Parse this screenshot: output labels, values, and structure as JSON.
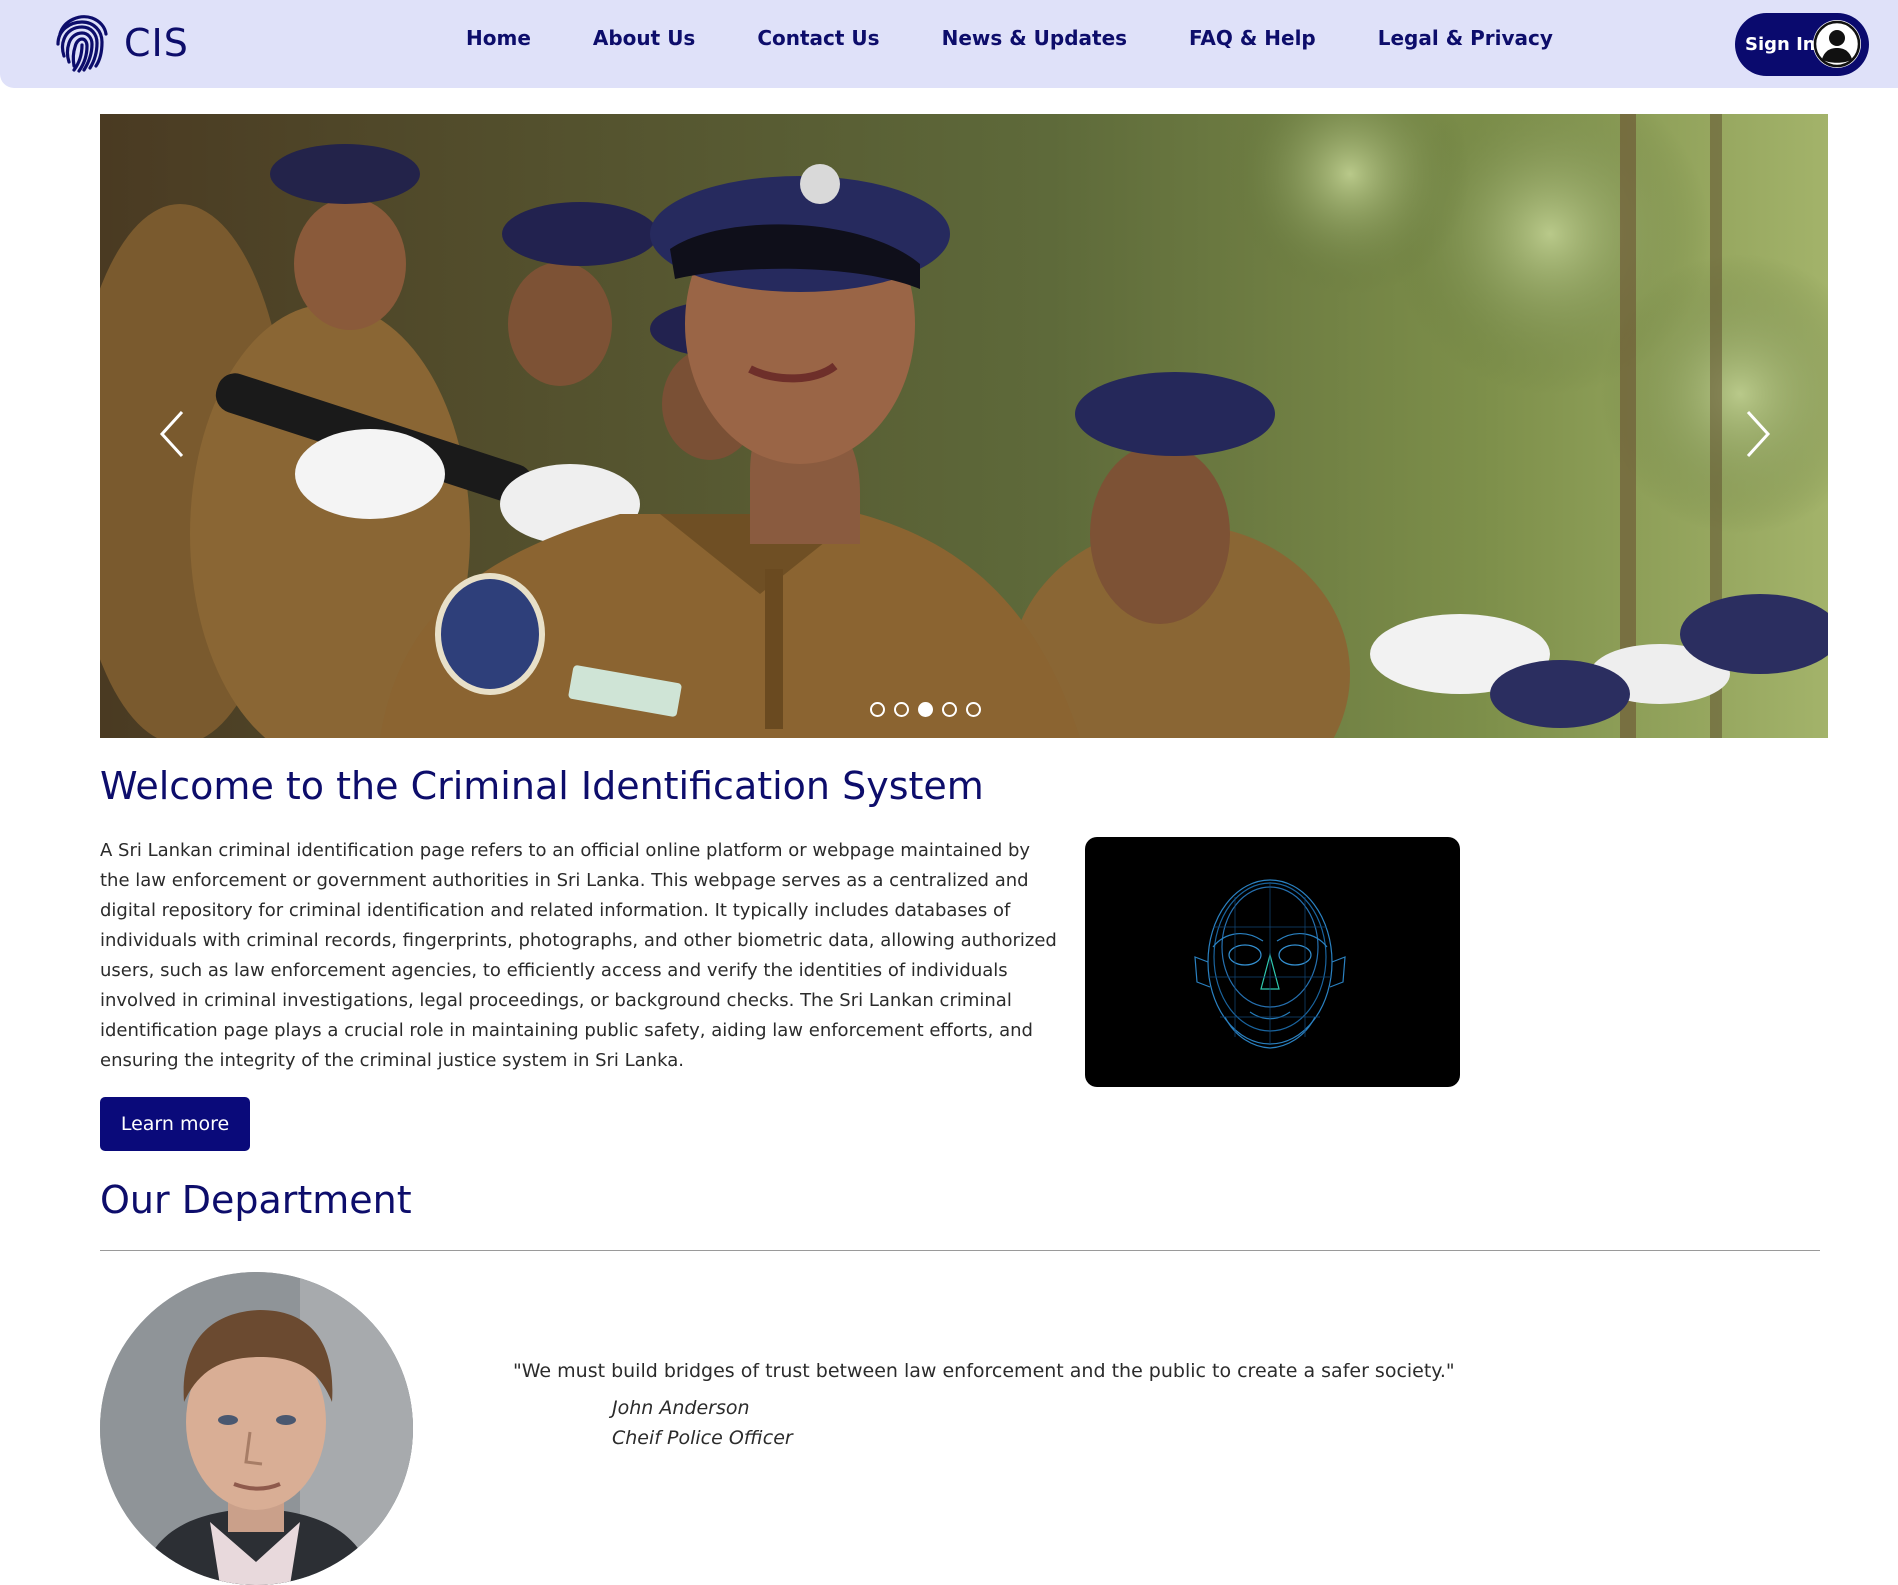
{
  "brand": {
    "name": "CIS",
    "color": "#0d0d6b",
    "logo_icon": "fingerprint-icon"
  },
  "header": {
    "background": "#dfe1f9"
  },
  "nav": {
    "items": [
      "Home",
      "About Us",
      "Contact Us",
      "News & Updates",
      "FAQ & Help",
      "Legal & Privacy"
    ]
  },
  "signin": {
    "label": "Sign In",
    "icon": "user-avatar-icon",
    "background": "#0a0a6e"
  },
  "carousel": {
    "image": "police-officers-parade-photo",
    "prev_icon": "chevron-left-icon",
    "next_icon": "chevron-right-icon",
    "slide_count": 5,
    "active_slide": 3
  },
  "welcome": {
    "title": "Welcome to the Criminal Identification System",
    "body": "A Sri Lankan criminal identification page refers to an official online platform or webpage maintained by the law enforcement or government authorities in Sri Lanka. This webpage serves as a centralized and digital repository for criminal identification and related information. It typically includes databases of individuals with criminal records, fingerprints, photographs, and other biometric data, allowing authorized users, such as law enforcement agencies, to efficiently access and verify the identities of individuals involved in criminal investigations, legal proceedings, or background checks. The Sri Lankan criminal identification page plays a crucial role in maintaining public safety, aiding law enforcement efforts, and ensuring the integrity of the criminal justice system in Sri Lanka.",
    "button_label": "Learn more",
    "image": "digital-face-scan-image"
  },
  "department": {
    "title": "Our Department",
    "quote": "\"We must build bridges of trust between law enforcement and the public to create a safer society.\"",
    "name": "John Anderson",
    "role": "Cheif Police Officer",
    "portrait": "officer-portrait-photo"
  }
}
